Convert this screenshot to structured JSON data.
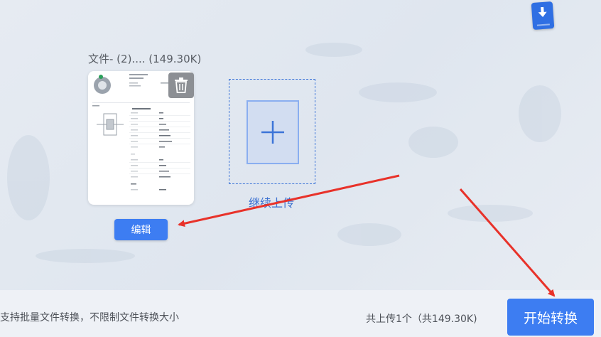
{
  "file": {
    "name_label": "文件- (2).... (149.30K)",
    "edit_label": "编辑"
  },
  "upload": {
    "continue_label": "继续上传"
  },
  "footer": {
    "note": "支持批量文件转换，不限制文件转换大小",
    "count": "共上传1个（共149.30K)",
    "start_label": "开始转换"
  },
  "icons": {
    "top_right": "download-icon",
    "delete": "trash-icon",
    "add": "plus-icon"
  },
  "colors": {
    "accent": "#3d7df2",
    "annotation_arrow": "#e8322a",
    "trash_bg": "#8c8f94"
  }
}
